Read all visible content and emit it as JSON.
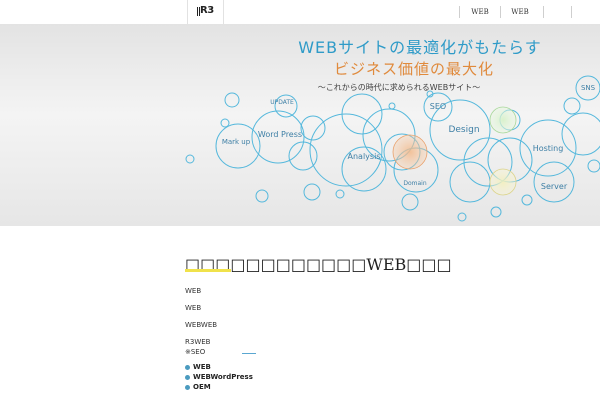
{
  "header": {
    "logo": "R3",
    "nav": [
      {
        "label": "WEB"
      },
      {
        "label": "WEB"
      }
    ]
  },
  "hero": {
    "title_line1": "WEBサイトの最適化がもたらす",
    "title_line2": "ビジネス価値の最大化",
    "subtitle": "〜これからの時代に求められるWEBサイト〜",
    "bubbles": [
      "UPDATE",
      "SEO",
      "SNS",
      "Mark up",
      "Word Press",
      "Design",
      "Analysis",
      "Hosting",
      "Domain",
      "Server"
    ],
    "colors": {
      "blue": "#2f9bc8",
      "orange": "#e08a3c",
      "text": "#3e7fa5"
    }
  },
  "main": {
    "heading": "□□□□□□□□□□□□WEB□□□",
    "paragraphs": [
      "WEB",
      "WEB",
      "WEBWEB",
      "R3WEB",
      "※SEO"
    ],
    "bullets": [
      "WEB",
      "WEBWordPress",
      "OEM"
    ]
  }
}
